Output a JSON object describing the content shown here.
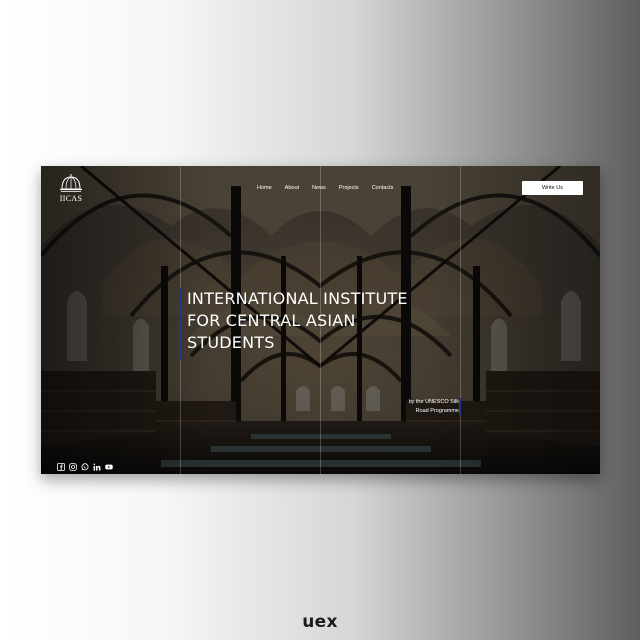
{
  "header": {
    "logo_text": "IICAS",
    "nav": [
      "Home",
      "About",
      "News",
      "Projects",
      "Contacts"
    ],
    "cta_label": "Write Us"
  },
  "hero": {
    "title_lines": [
      "INTERNATIONAL INSTITUTE",
      "FOR CENTRAL ASIAN",
      "STUDENTS"
    ],
    "subtitle_lines": [
      "by the  UNESCO Silk",
      "Road Programme"
    ],
    "accent_color": "#23348a",
    "background_image": "library-reading-room-photo"
  },
  "socials": [
    "facebook-icon",
    "instagram-icon",
    "whatsapp-icon",
    "linkedin-icon",
    "youtube-icon"
  ],
  "brand_mark": "uex"
}
